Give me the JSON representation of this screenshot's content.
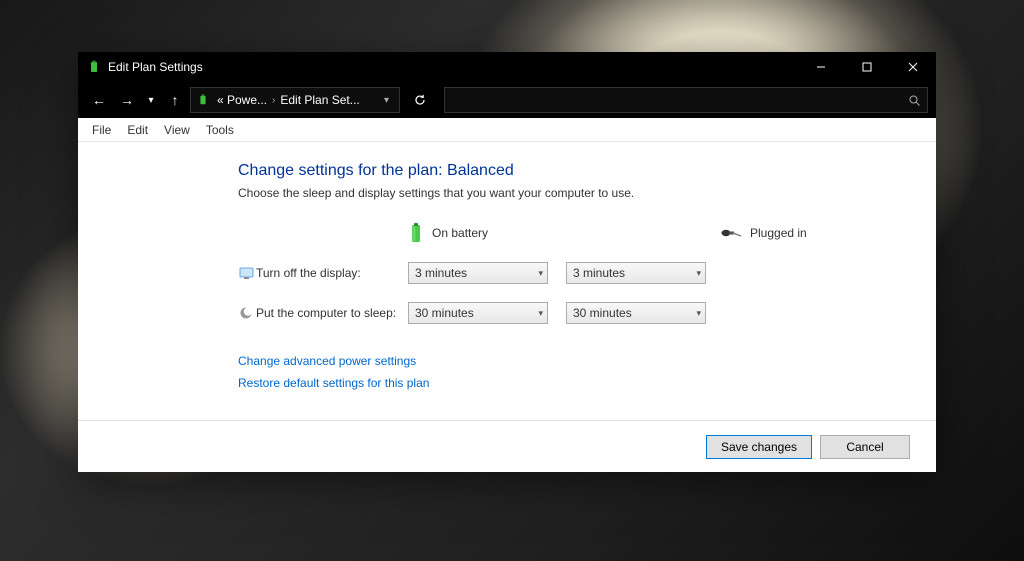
{
  "window": {
    "title": "Edit Plan Settings"
  },
  "breadcrumb": {
    "seg1": "« Powe...",
    "seg2": "Edit Plan Set..."
  },
  "menubar": {
    "file": "File",
    "edit": "Edit",
    "view": "View",
    "tools": "Tools"
  },
  "content": {
    "heading": "Change settings for the plan: Balanced",
    "description": "Choose the sleep and display settings that you want your computer to use.",
    "col_battery": "On battery",
    "col_plugged": "Plugged in",
    "row_display_label": "Turn off the display:",
    "row_display_battery": "3 minutes",
    "row_display_plugged": "3 minutes",
    "row_sleep_label": "Put the computer to sleep:",
    "row_sleep_battery": "30 minutes",
    "row_sleep_plugged": "30 minutes",
    "link_advanced": "Change advanced power settings",
    "link_restore": "Restore default settings for this plan"
  },
  "footer": {
    "save": "Save changes",
    "cancel": "Cancel"
  }
}
